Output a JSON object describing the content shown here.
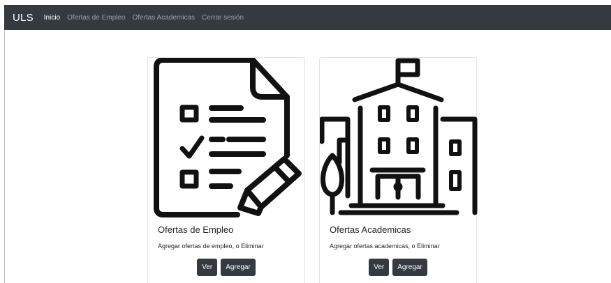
{
  "navbar": {
    "brand": "ULS",
    "links": [
      {
        "label": "Inicio",
        "active": true
      },
      {
        "label": "Ofertas de Empleo",
        "active": false
      },
      {
        "label": "Ofertas Academicas",
        "active": false
      },
      {
        "label": "Cerrar sesión",
        "active": false
      }
    ]
  },
  "cards": [
    {
      "title": "Ofertas de Empleo",
      "text": "Agregar ofertas de empleo, o Eliminar",
      "view_label": "Ver",
      "add_label": "Agregar",
      "icon": "checklist-document-icon"
    },
    {
      "title": "Ofertas Academicas",
      "text": "Agregar ofertas academicas, o Eliminar",
      "view_label": "Ver",
      "add_label": "Agregar",
      "icon": "school-building-icon"
    }
  ],
  "colors": {
    "navbar_bg": "#343a40",
    "button_bg": "#343a40",
    "icon_stroke": "#111111"
  }
}
